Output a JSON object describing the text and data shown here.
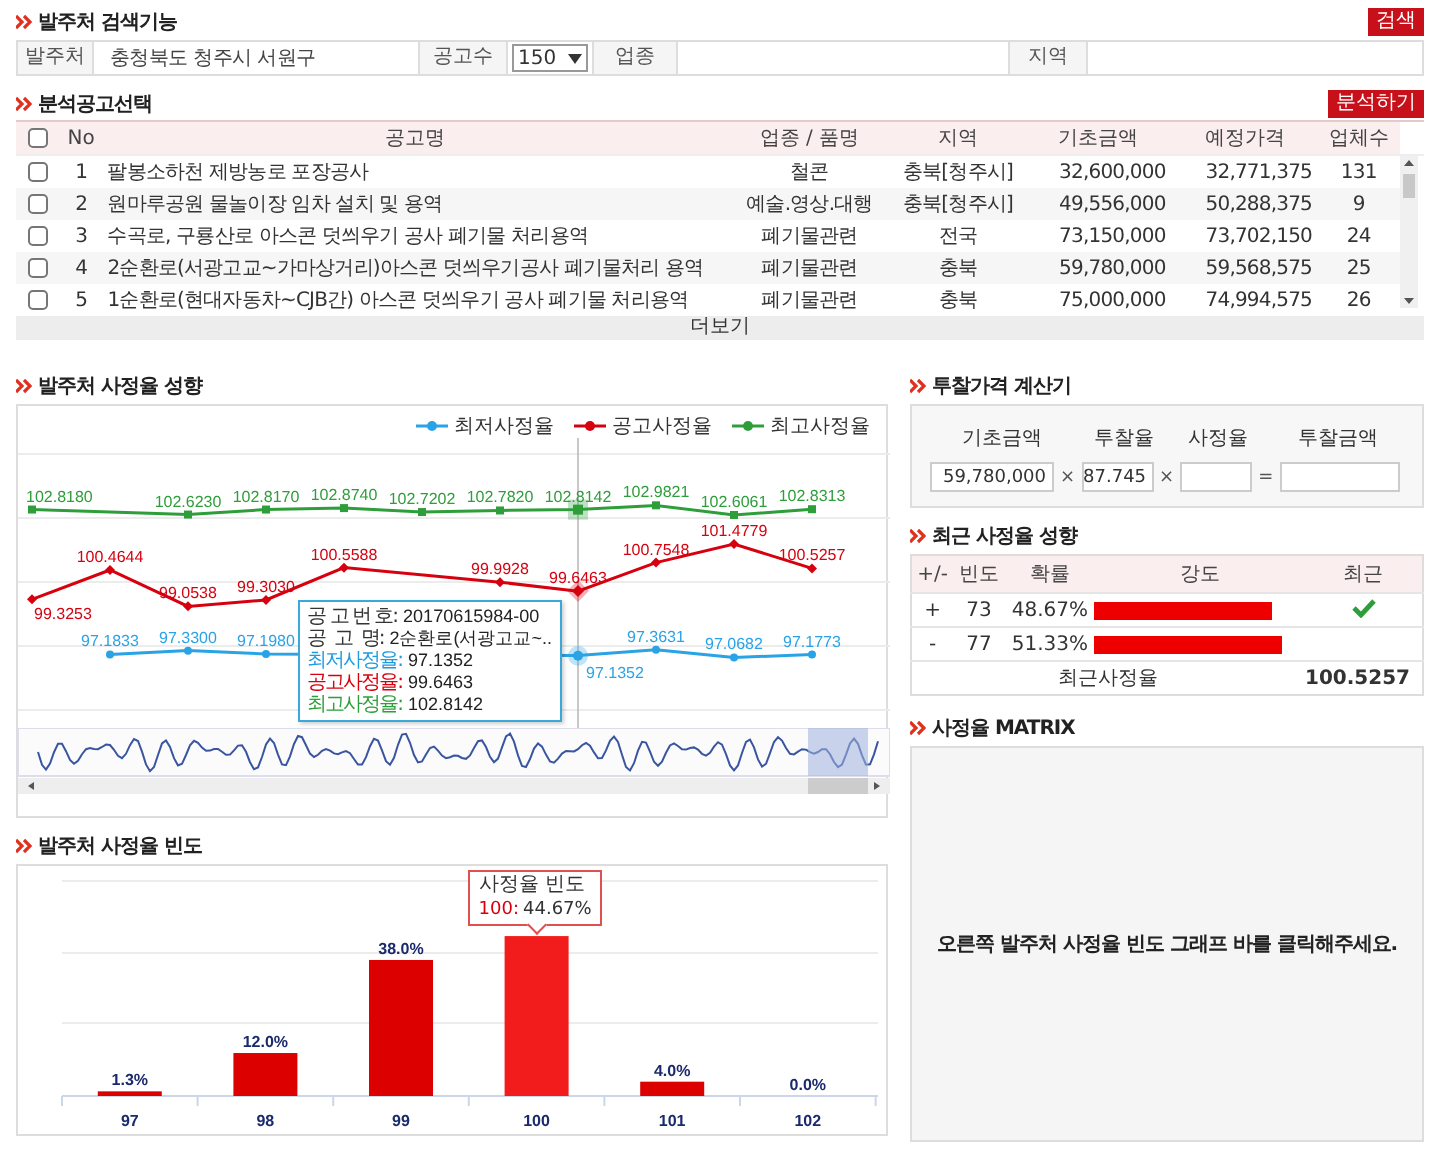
{
  "search": {
    "title": "발주처 검색기능",
    "button": "검색",
    "fields": [
      {
        "label": "발주처",
        "kind": "text",
        "value": "충청북도 청주시 서원구"
      },
      {
        "label": "공고수",
        "kind": "select",
        "value": "150"
      },
      {
        "label": "업종",
        "kind": "text"
      },
      {
        "label": "지역",
        "kind": "text"
      }
    ]
  },
  "notices": {
    "title": "분석공고선택",
    "button": "분석하기",
    "all_checked": false,
    "columns": [
      "No",
      "공고명",
      "업종 / 품명",
      "지역",
      "기초금액",
      "예정가격",
      "업체수"
    ],
    "rows": [
      {
        "checked": false,
        "cells": [
          "1",
          "팔봉소하천 제방농로 포장공사",
          "철콘",
          "충북[청주시]",
          "32,600,000",
          "32,771,375",
          "131"
        ]
      },
      {
        "checked": false,
        "cells": [
          "2",
          "원마루공원 물놀이장 임차 설치 및 용역",
          "예술.영상.대행",
          "충북[청주시]",
          "49,556,000",
          "50,288,375",
          "9"
        ]
      },
      {
        "checked": false,
        "cells": [
          "3",
          "수곡로, 구룡산로 아스콘 덧씌우기 공사 폐기물 처리용역",
          "폐기물관련",
          "전국",
          "73,150,000",
          "73,702,150",
          "24"
        ]
      },
      {
        "checked": false,
        "cells": [
          "4",
          "2순환로(서광고교~가마상거리)아스콘 덧씌우기공사 폐기물처리 용역",
          "폐기물관련",
          "충북",
          "59,780,000",
          "59,568,575",
          "25"
        ]
      },
      {
        "checked": false,
        "cells": [
          "5",
          "1순환로(현대자동차~CJB간) 아스콘 덧씌우기 공사 폐기물 처리용역",
          "폐기물관련",
          "충북",
          "75,000,000",
          "74,994,575",
          "26"
        ]
      }
    ],
    "more": "더보기"
  },
  "trend": {
    "title": "발주처 사정율 성향",
    "chart_data": {
      "type": "line",
      "legend": "top-right",
      "series": [
        {
          "name": "최저사정율",
          "color": "#2aa3e6",
          "marker": "circle",
          "values": [
            null,
            97.1833,
            97.33,
            97.198,
            null,
            null,
            null,
            97.1352,
            97.3631,
            97.0682,
            97.1773
          ],
          "value_labels": [
            null,
            "97.1833",
            "97.3300",
            "97.1980",
            null,
            null,
            null,
            "97.1352",
            "97.3631",
            "97.0682",
            "97.1773"
          ]
        },
        {
          "name": "공고사정율",
          "color": "#d7000f",
          "marker": "diamond",
          "values": [
            99.3253,
            100.4644,
            99.0538,
            99.303,
            100.5588,
            null,
            99.9928,
            99.6463,
            100.7548,
            101.4779,
            100.5257
          ],
          "value_labels": [
            "99.3253",
            "100.4644",
            "99.0538",
            "99.3030",
            "100.5588",
            null,
            "99.9928",
            "99.6463",
            "100.7548",
            "101.4779",
            "100.5257"
          ]
        },
        {
          "name": "최고사정율",
          "color": "#2e9e3a",
          "marker": "square",
          "values": [
            102.818,
            null,
            102.623,
            102.817,
            102.874,
            102.7202,
            102.782,
            102.8142,
            102.9821,
            102.6061,
            102.8313
          ],
          "value_labels": [
            "102.8180",
            null,
            "102.6230",
            "102.8170",
            "102.8740",
            "102.7202",
            "102.7820",
            "102.8142",
            "102.9821",
            "102.6061",
            "102.8313"
          ]
        }
      ]
    },
    "tooltip": [
      {
        "label": "공 고 번 호:",
        "value": "20170615984-00"
      },
      {
        "label": "공  고  명:",
        "value": "2순환로(서광고교~.."
      },
      {
        "label": "최저사정율:",
        "value": "97.1352",
        "color": "#1e9be0"
      },
      {
        "label": "공고사정율:",
        "value": "99.6463",
        "color": "#d7000f"
      },
      {
        "label": "최고사정율:",
        "value": "102.8142",
        "color": "#2e9e3a"
      }
    ]
  },
  "frequency": {
    "title": "발주처 사정율 빈도",
    "chart_data": {
      "type": "bar",
      "categories": [
        "97",
        "98",
        "99",
        "100",
        "101",
        "102"
      ],
      "values": [
        1.3,
        12.0,
        38.0,
        44.67,
        4.0,
        0.0
      ],
      "value_labels": [
        "1.3%",
        "12.0%",
        "38.0%",
        null,
        "4.0%",
        "0.0%"
      ]
    },
    "tooltip": {
      "title": "사정율 빈도",
      "label": "100:",
      "value": "44.67%"
    }
  },
  "calculator": {
    "title": "투찰가격 계산기",
    "fields": [
      {
        "label": "기초금액",
        "value": "59,780,000"
      },
      {
        "label": "투찰율",
        "value": "87.745"
      },
      {
        "label": "사정율"
      },
      {
        "label": "투찰금액"
      }
    ],
    "operators": [
      "×",
      "×",
      "="
    ]
  },
  "recent": {
    "title": "최근 사정율 성향",
    "columns": [
      "+/-",
      "빈도",
      "확률",
      "강도",
      "최근"
    ],
    "rows": [
      {
        "sign": "+",
        "count": "73",
        "rate": "48.67%",
        "level": 0.89,
        "recent": true
      },
      {
        "sign": "-",
        "count": "77",
        "rate": "51.33%",
        "level": 0.94,
        "recent": false
      }
    ],
    "footer_label": "최근사정율",
    "footer_value": "100.5257"
  },
  "matrix": {
    "title": "사정율 MATRIX",
    "message": "오른쪽 발주처 사정율 빈도 그래프 바를 클릭해주세요."
  }
}
